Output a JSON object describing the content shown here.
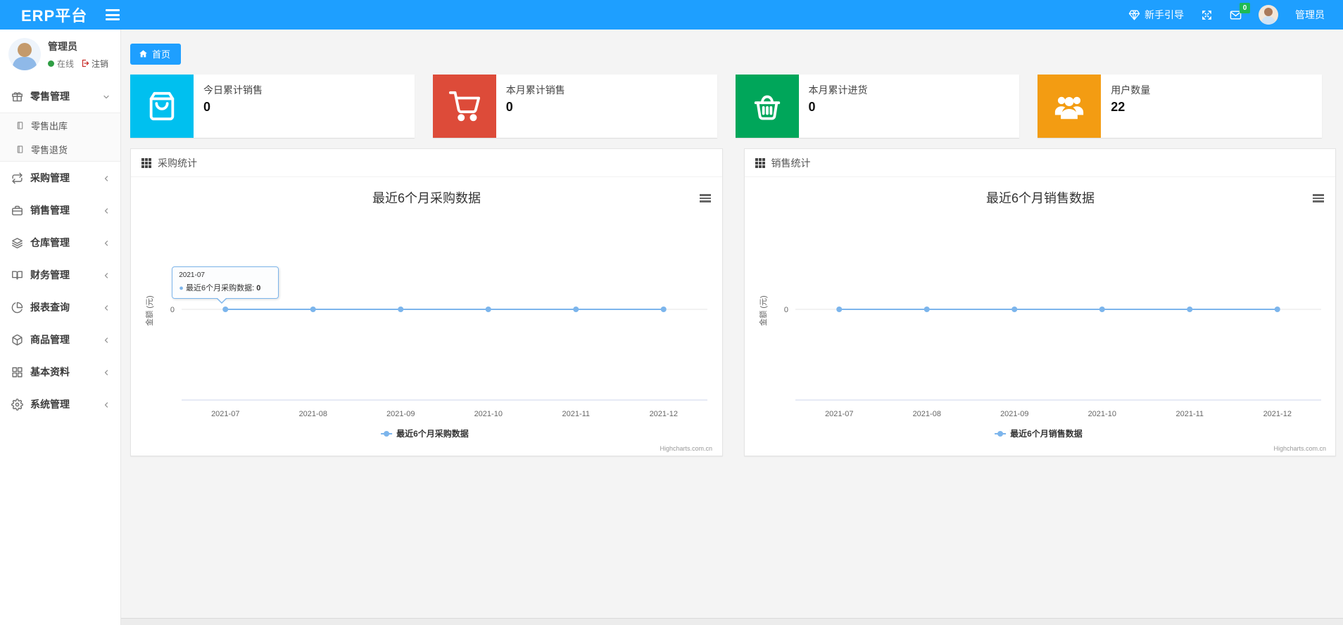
{
  "colors": {
    "accent": "#1E9FFF",
    "badge_green": "#1fba54",
    "chart_line": "#7cb5ec",
    "card_aqua": "#00c0ef",
    "card_red": "#dd4b39",
    "card_green": "#00a65a",
    "card_orange": "#f39c12"
  },
  "navbar": {
    "logo": "ERP平台",
    "menu_icon": "menu-icon",
    "guide_label": "新手引导",
    "guide_icon": "gem-icon",
    "fullscreen_icon": "expand-icon",
    "mail_icon": "envelope-icon",
    "message_badge": "0",
    "username": "管理员"
  },
  "user_panel": {
    "name": "管理员",
    "status_label": "在线",
    "logout_label": "注销"
  },
  "sidebar": {
    "items": [
      {
        "label": "零售管理",
        "icon": "gift-icon",
        "chevron": "down",
        "children": [
          {
            "label": "零售出库",
            "icon": "file-icon"
          },
          {
            "label": "零售退货",
            "icon": "file-icon"
          }
        ]
      },
      {
        "label": "采购管理",
        "icon": "repeat-icon",
        "chevron": "left"
      },
      {
        "label": "销售管理",
        "icon": "briefcase-icon",
        "chevron": "left"
      },
      {
        "label": "仓库管理",
        "icon": "layers-icon",
        "chevron": "left"
      },
      {
        "label": "财务管理",
        "icon": "book-icon",
        "chevron": "left"
      },
      {
        "label": "报表查询",
        "icon": "pie-chart-icon",
        "chevron": "left"
      },
      {
        "label": "商品管理",
        "icon": "box-icon",
        "chevron": "left"
      },
      {
        "label": "基本资料",
        "icon": "grid-icon",
        "chevron": "left"
      },
      {
        "label": "系统管理",
        "icon": "gear-icon",
        "chevron": "left"
      }
    ]
  },
  "tabs": {
    "home_label": "首页",
    "home_icon": "home-icon"
  },
  "cards": [
    {
      "label": "今日累计销售",
      "value": "0",
      "color": "#00c0ef",
      "icon": "shopping-bag-icon"
    },
    {
      "label": "本月累计销售",
      "value": "0",
      "color": "#dd4b39",
      "icon": "cart-icon"
    },
    {
      "label": "本月累计进货",
      "value": "0",
      "color": "#00a65a",
      "icon": "basket-icon"
    },
    {
      "label": "用户数量",
      "value": "22",
      "color": "#f39c12",
      "icon": "users-icon"
    }
  ],
  "panels": [
    {
      "header": "采购统计",
      "header_icon": "th-grid-icon"
    },
    {
      "header": "销售统计",
      "header_icon": "th-grid-icon"
    }
  ],
  "chart_data": [
    {
      "type": "line",
      "title": "最近6个月采购数据",
      "categories": [
        "2021-07",
        "2021-08",
        "2021-09",
        "2021-10",
        "2021-11",
        "2021-12"
      ],
      "series": [
        {
          "name": "最近6个月采购数据",
          "values": [
            0,
            0,
            0,
            0,
            0,
            0
          ],
          "color": "#7cb5ec"
        }
      ],
      "xlabel": "",
      "ylabel": "金额 (元)",
      "y_ticks": [
        "0"
      ],
      "grid": true,
      "legend_position": "bottom",
      "credits": "Highcharts.com.cn",
      "tooltip": {
        "category": "2021-07",
        "series": "最近6个月采购数据",
        "value": "0"
      }
    },
    {
      "type": "line",
      "title": "最近6个月销售数据",
      "categories": [
        "2021-07",
        "2021-08",
        "2021-09",
        "2021-10",
        "2021-11",
        "2021-12"
      ],
      "series": [
        {
          "name": "最近6个月销售数据",
          "values": [
            0,
            0,
            0,
            0,
            0,
            0
          ],
          "color": "#7cb5ec"
        }
      ],
      "xlabel": "",
      "ylabel": "金额 (元)",
      "y_ticks": [
        "0"
      ],
      "grid": true,
      "legend_position": "bottom",
      "credits": "Highcharts.com.cn",
      "tooltip": null
    }
  ]
}
